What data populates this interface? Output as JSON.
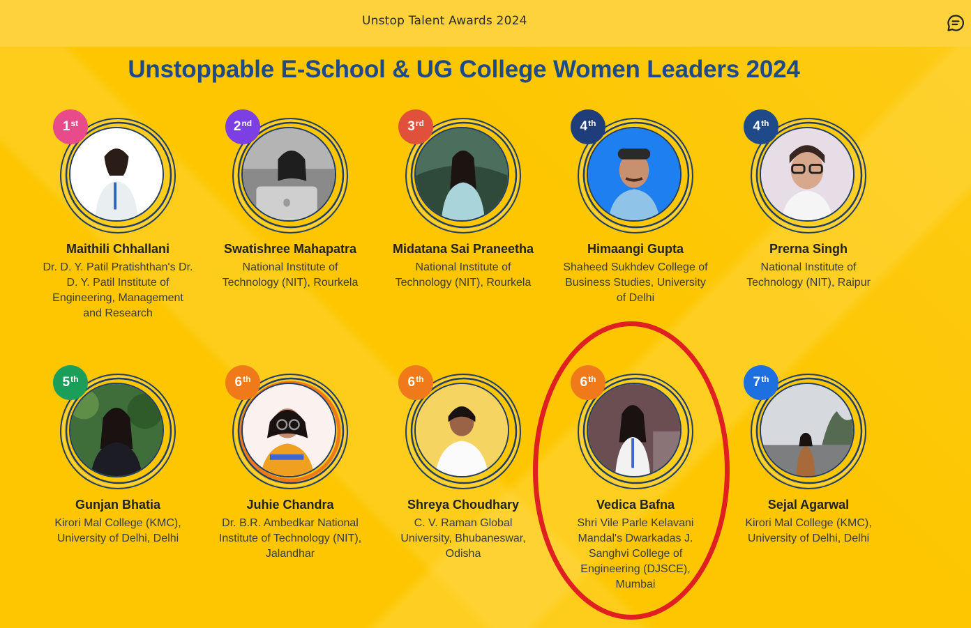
{
  "topbar": {
    "title": "Unstop Talent Awards 2024",
    "chat_icon": "chat-bubble-icon"
  },
  "page_title": "Unstoppable E-School & UG College Women Leaders 2024",
  "colors": {
    "background": "#fdc600",
    "topbar": "#fed23c",
    "title": "#1f4a8a",
    "ring": "#1f3d6b",
    "highlight": "#e02020"
  },
  "winners": [
    {
      "rank": "1",
      "suffix": "st",
      "badge_color": "#e84a8a",
      "name": "Maithili Chhallani",
      "institution": "Dr. D. Y. Patil Pratishthan's Dr. D. Y. Patil Institute of Engineering, Management and Research"
    },
    {
      "rank": "2",
      "suffix": "nd",
      "badge_color": "#7b3fe4",
      "name": "Swatishree Mahapatra",
      "institution": "National Institute of Technology (NIT), Rourkela"
    },
    {
      "rank": "3",
      "suffix": "rd",
      "badge_color": "#e0503a",
      "name": "Midatana Sai Praneetha",
      "institution": "National Institute of Technology (NIT), Rourkela"
    },
    {
      "rank": "4",
      "suffix": "th",
      "badge_color": "#1f3d7a",
      "name": "Himaangi Gupta",
      "institution": "Shaheed Sukhdev College of Business Studies, University of Delhi"
    },
    {
      "rank": "4",
      "suffix": "th",
      "badge_color": "#1f4a8a",
      "name": "Prerna Singh",
      "institution": "National Institute of Technology (NIT), Raipur"
    },
    {
      "rank": "5",
      "suffix": "th",
      "badge_color": "#1a9e5a",
      "name": "Gunjan Bhatia",
      "institution": "Kirori Mal College (KMC), University of Delhi, Delhi"
    },
    {
      "rank": "6",
      "suffix": "th",
      "badge_color": "#f07a1a",
      "name": "Juhie Chandra",
      "institution": "Dr. B.R. Ambedkar National Institute of Technology (NIT), Jalandhar"
    },
    {
      "rank": "6",
      "suffix": "th",
      "badge_color": "#f07a1a",
      "name": "Shreya Choudhary",
      "institution": "C. V. Raman Global University, Bhubaneswar, Odisha"
    },
    {
      "rank": "6",
      "suffix": "th",
      "badge_color": "#f07a1a",
      "name": "Vedica Bafna",
      "institution": "Shri Vile Parle Kelavani Mandal's Dwarkadas J. Sanghvi College of Engineering (DJSCE), Mumbai"
    },
    {
      "rank": "7",
      "suffix": "th",
      "badge_color": "#1e6fe0",
      "name": "Sejal Agarwal",
      "institution": "Kirori Mal College (KMC), University of Delhi, Delhi"
    }
  ]
}
